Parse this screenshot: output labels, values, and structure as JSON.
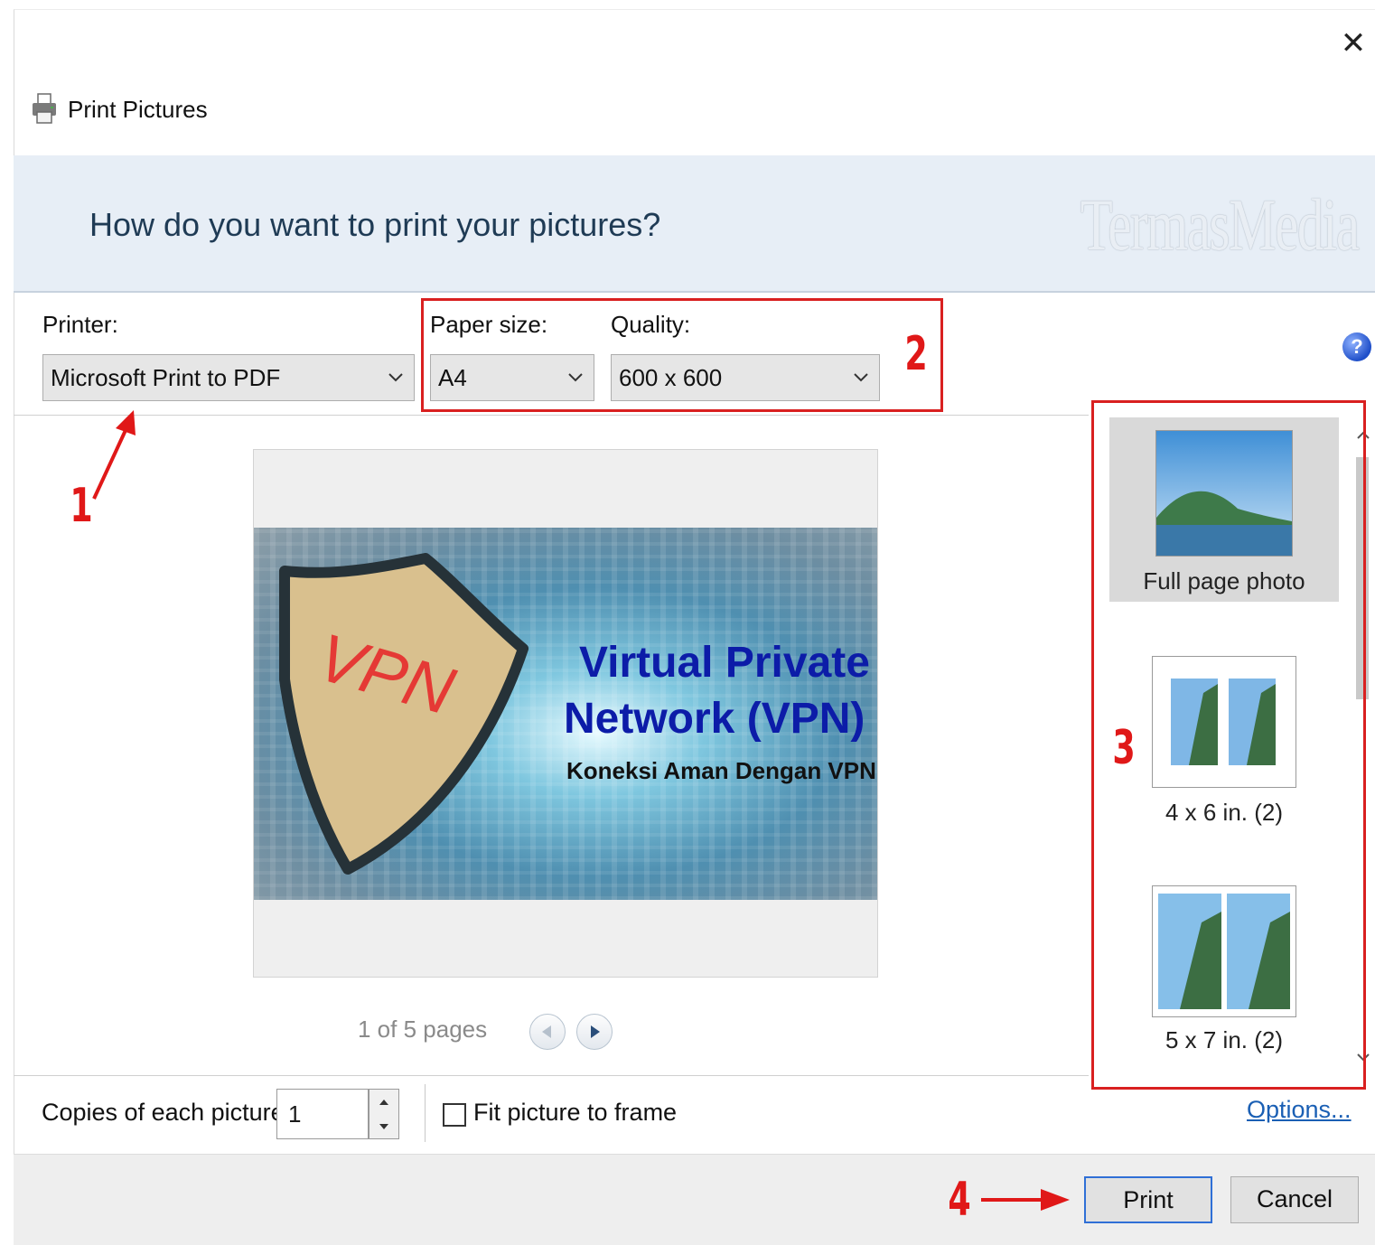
{
  "window": {
    "title": "Print Pictures",
    "close_glyph": "✕"
  },
  "banner": {
    "heading": "How do you want to print your pictures?",
    "watermark": "TermasMedia"
  },
  "printer": {
    "label": "Printer:",
    "value": "Microsoft Print to PDF"
  },
  "paper_size": {
    "label": "Paper size:",
    "value": "A4"
  },
  "quality": {
    "label": "Quality:",
    "value": "600 x 600"
  },
  "annotations": {
    "n1": "1",
    "n2": "2",
    "n3": "3",
    "n4": "4",
    "color": "#d92020"
  },
  "help": {
    "glyph": "?"
  },
  "preview": {
    "shield_text": "VPN",
    "title_line1": "Virtual Private",
    "title_line2": "Network (VPN)",
    "subtitle": "Koneksi Aman Dengan VPN",
    "pager": "1 of 5 pages"
  },
  "layouts": [
    {
      "label": "Full page photo",
      "selected": true
    },
    {
      "label": "4 x 6 in. (2)",
      "selected": false
    },
    {
      "label": "5 x 7 in. (2)",
      "selected": false
    }
  ],
  "copies": {
    "label": "Copies of each picture:",
    "value": "1"
  },
  "fit": {
    "label": "Fit picture to frame",
    "checked": false
  },
  "options_link": "Options...",
  "buttons": {
    "print": "Print",
    "cancel": "Cancel"
  },
  "colors": {
    "accent": "#2f6fd6",
    "banner_bg": "#e7eef6",
    "heading": "#1f3b55",
    "vpn_title": "#0c1ca8"
  }
}
